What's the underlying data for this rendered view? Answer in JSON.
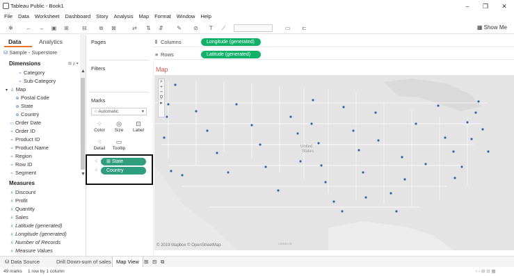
{
  "window": {
    "title": "Tableau Public - Book1",
    "minimize": "–",
    "restore": "❐",
    "close": "✕"
  },
  "menu": [
    "File",
    "Data",
    "Worksheet",
    "Dashboard",
    "Story",
    "Analysis",
    "Map",
    "Format",
    "Window",
    "Help"
  ],
  "toolbar": {
    "show_me": "Show Me"
  },
  "data_pane": {
    "tab_data": "Data",
    "tab_analytics": "Analytics",
    "data_source": "Sample - Superstore",
    "dimensions_header": "Dimensions",
    "dimensions": [
      {
        "label": "Category",
        "icon": "abc-icon"
      },
      {
        "label": "Sub-Category",
        "icon": "abc-icon"
      },
      {
        "label": "Map",
        "icon": "hierarchy-icon"
      },
      {
        "label": "Postal Code",
        "icon": "globe-icon"
      },
      {
        "label": "State",
        "icon": "globe-icon"
      },
      {
        "label": "Country",
        "icon": "globe-icon"
      },
      {
        "label": "Order Date",
        "icon": "calendar-icon"
      },
      {
        "label": "Order ID",
        "icon": "abc-icon"
      },
      {
        "label": "Product ID",
        "icon": "abc-icon"
      },
      {
        "label": "Product Name",
        "icon": "abc-icon"
      },
      {
        "label": "Region",
        "icon": "abc-icon"
      },
      {
        "label": "Row ID",
        "icon": "abc-icon"
      },
      {
        "label": "Segment",
        "icon": "abc-icon"
      }
    ],
    "measures_header": "Measures",
    "measures": [
      {
        "label": "Discount",
        "italic": false
      },
      {
        "label": "Profit",
        "italic": false
      },
      {
        "label": "Quantity",
        "italic": false
      },
      {
        "label": "Sales",
        "italic": false
      },
      {
        "label": "Latitude (generated)",
        "italic": true
      },
      {
        "label": "Longitude (generated)",
        "italic": true
      },
      {
        "label": "Number of Records",
        "italic": true
      },
      {
        "label": "Measure Values",
        "italic": true
      }
    ]
  },
  "cards": {
    "pages": "Pages",
    "filters": "Filters",
    "marks": "Marks",
    "marks_type": "Automatic",
    "buttons": [
      {
        "label": "Color",
        "icon": "color-icon"
      },
      {
        "label": "Size",
        "icon": "size-icon"
      },
      {
        "label": "Label",
        "icon": "label-icon"
      },
      {
        "label": "Detail",
        "icon": "detail-icon"
      },
      {
        "label": "Tooltip",
        "icon": "tooltip-icon"
      }
    ],
    "detail_pills": [
      "State",
      "Country"
    ]
  },
  "shelves": {
    "columns_label": "Columns",
    "columns_pill": "Longitude (generated)",
    "rows_label": "Rows",
    "rows_pill": "Latitude (generated)"
  },
  "view": {
    "title": "Map",
    "attribution": "© 2019 Mapbox © OpenStreetMap",
    "country_label_1": "United",
    "country_label_2": "States",
    "city_label": "Laredo de"
  },
  "sheet_tabs": {
    "data_source": "Data Source",
    "sheets": [
      "Drill Down-sum of sales",
      "Map View"
    ],
    "active": "Map View"
  },
  "status": {
    "marks": "49 marks",
    "dims": "1 row by 1 column"
  },
  "colors": {
    "pill_blue": "#2f9e7e",
    "pill_green": "#11b169",
    "map_title": "#d9534f",
    "mark_point": "#2e6aa8"
  }
}
